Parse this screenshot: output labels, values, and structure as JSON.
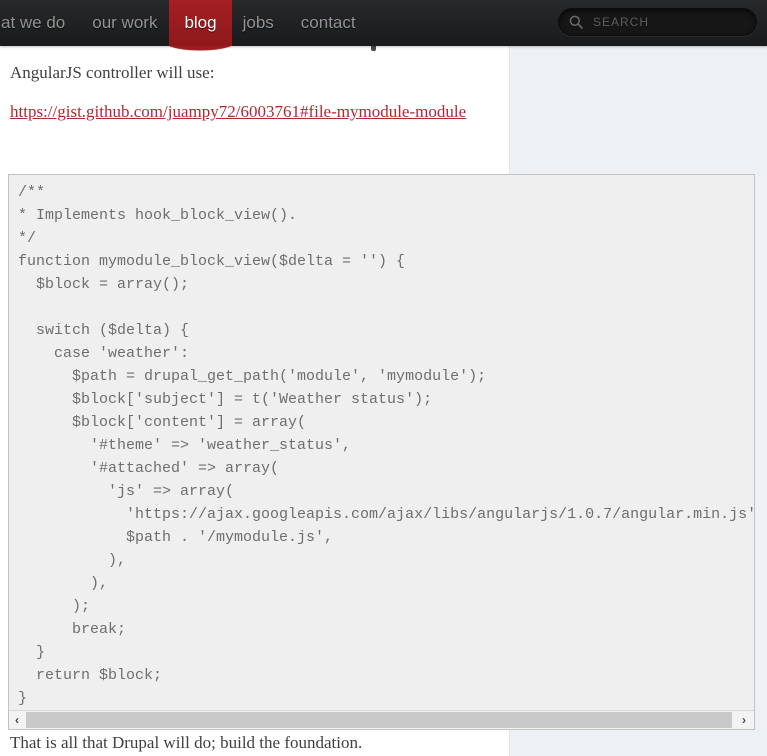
{
  "nav": {
    "items": [
      {
        "label": "at we do"
      },
      {
        "label": "our work"
      },
      {
        "label": "blog",
        "active": true
      },
      {
        "label": "jobs"
      },
      {
        "label": "contact"
      }
    ],
    "search": {
      "placeholder": "SEARCH",
      "value": ""
    }
  },
  "article": {
    "intro_text": "AngularJS controller will use:",
    "gist_link": "https://gist.github.com/juampy72/6003761#file-mymodule-module",
    "code": "/**\n* Implements hook_block_view().\n*/\nfunction mymodule_block_view($delta = '') {\n  $block = array();\n\n  switch ($delta) {\n    case 'weather':\n      $path = drupal_get_path('module', 'mymodule');\n      $block['subject'] = t('Weather status');\n      $block['content'] = array(\n        '#theme' => 'weather_status',\n        '#attached' => array(\n          'js' => array(\n            'https://ajax.googleapis.com/ajax/libs/angularjs/1.0.7/angular.min.js',\n            $path . '/mymodule.js',\n          ),\n        ),\n      );\n      break;\n  }\n  return $block;\n}",
    "outro_text": "That is all that Drupal will do; build the foundation."
  },
  "scrollbar": {
    "left_arrow": "‹",
    "right_arrow": "›"
  },
  "colors": {
    "accent_red": "#9c1b1e",
    "link_red": "#b3282d",
    "nav_bg": "#1f2021",
    "nav_text": "#939393",
    "panel_blue": "#edf1f5",
    "code_bg": "#efefef",
    "code_border": "#c2c2c2",
    "code_text": "#6e6e6e"
  }
}
